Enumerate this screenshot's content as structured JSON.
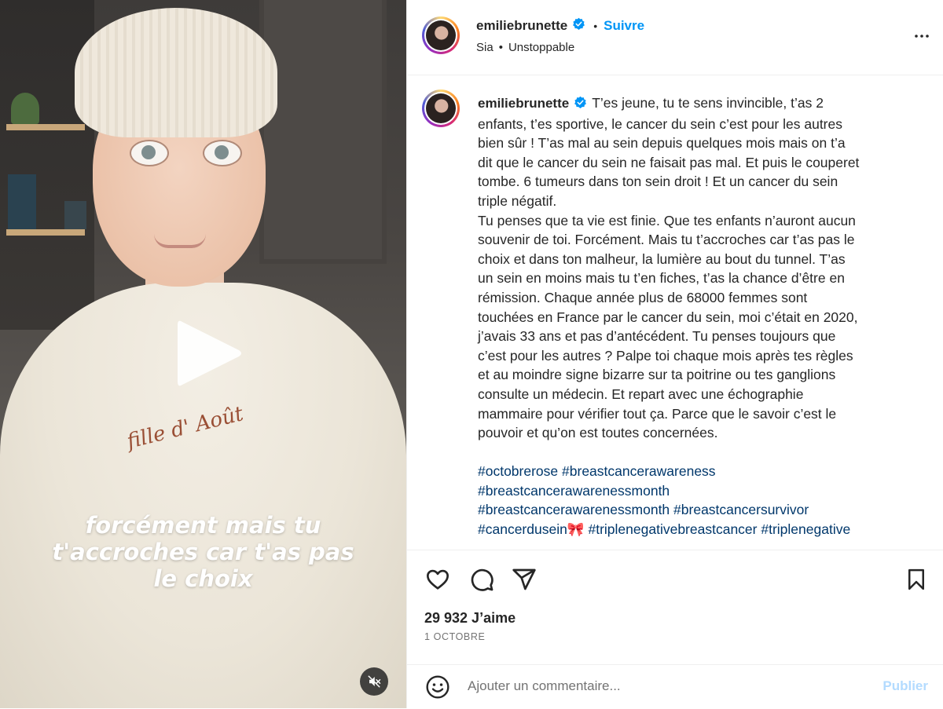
{
  "video": {
    "overlay_caption": [
      "forcément mais tu",
      "t'accroches car t'as pas",
      "le choix"
    ],
    "sweater_embroidery": "fille d' Août",
    "play_icon": "play-icon",
    "mute_icon": "muted-speaker-icon"
  },
  "header": {
    "username": "emiliebrunette",
    "verified_icon": "verified-badge-icon",
    "separator": "•",
    "follow_label": "Suivre",
    "audio_artist": "Sia",
    "audio_separator": "•",
    "audio_track": "Unstoppable",
    "more_icon": "more-options-icon"
  },
  "post": {
    "username": "emiliebrunette",
    "caption_lines": [
      "T’es jeune, tu te sens invincible, t’as 2",
      "enfants, t’es sportive, le cancer du sein c’est pour les autres",
      "bien sûr ! T’as mal au sein depuis quelques mois mais on t’a",
      "dit que le cancer du sein ne faisait pas mal. Et puis le couperet",
      "tombe. 6 tumeurs dans ton sein droit ! Et un cancer du sein",
      "triple négatif.",
      "Tu penses que ta vie est finie. Que tes enfants n’auront aucun",
      "souvenir de toi. Forcément. Mais tu t’accroches car t’as pas le",
      "choix et dans ton malheur, la lumière au bout du tunnel. T’as",
      "un sein en moins mais tu t’en fiches, t’as la chance d’être en",
      "rémission. Chaque année plus de 68000 femmes sont",
      "touchées en France par le cancer du sein, moi c’était en 2020,",
      "j’avais 33 ans et pas d’antécédent. Tu penses toujours que",
      "c’est pour les autres ? Palpe toi chaque mois après tes règles",
      "et au moindre signe bizarre sur ta poitrine ou tes ganglions",
      "consulte un médecin. Et repart avec une échographie",
      "mammaire pour vérifier tout ça. Parce que le savoir c’est le",
      "pouvoir et qu’on est toutes concernées."
    ],
    "hashtags": {
      "line1": [
        "#octobrerose",
        "#breastcancerawareness"
      ],
      "line2": [
        "#breastcancerawarenessmonth"
      ],
      "line3": [
        "#breastcancerawarenessmonth",
        "#breastcancersurvivor"
      ],
      "line4": [
        "#cancerdusein🎀",
        "#triplenegativebreastcancer",
        "#triplenegative"
      ]
    }
  },
  "actions": {
    "like_icon": "heart-icon",
    "comment_icon": "comment-bubble-icon",
    "share_icon": "paper-plane-icon",
    "save_icon": "bookmark-icon",
    "likes_count": "29 932 J’aime",
    "date": "1 OCTOBRE"
  },
  "comment_box": {
    "emoji_icon": "smiley-icon",
    "placeholder": "Ajouter un commentaire...",
    "publish_label": "Publier"
  },
  "colors": {
    "link_blue": "#0095f6",
    "hashtag_blue": "#00376b",
    "publish_disabled": "#b3dbff",
    "verified_blue": "#0095f6"
  }
}
